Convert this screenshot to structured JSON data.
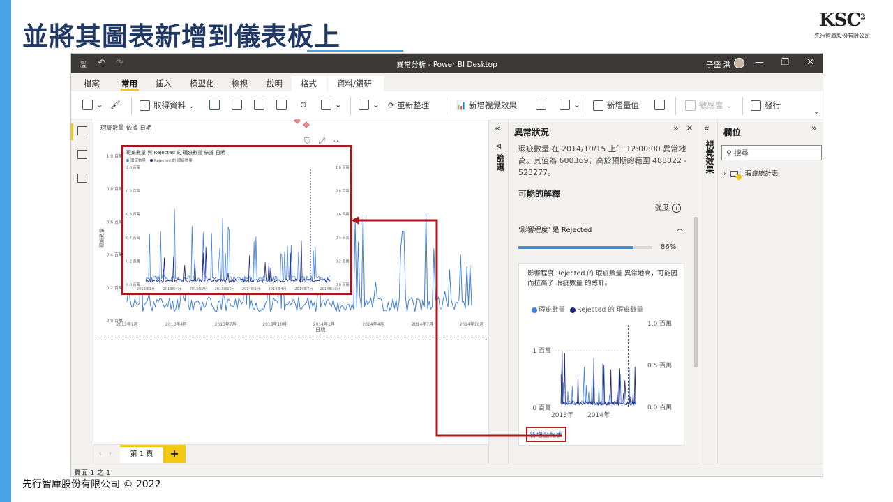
{
  "slide": {
    "title": "並將其圖表新增到儀表板上",
    "footer": "先行智庫股份有限公司 © 2022",
    "logo_main": "KSC",
    "logo_sup": "2",
    "logo_sub": "先行智庫股份有限公司"
  },
  "window": {
    "title": "異常分析 - Power BI Desktop",
    "user": "子盛 洪"
  },
  "menu": {
    "items": [
      "檔案",
      "常用",
      "插入",
      "模型化",
      "檢視",
      "說明",
      "格式",
      "資料/鑽研"
    ],
    "active": "常用"
  },
  "ribbon": {
    "get_data": "取得資料",
    "refresh": "重新整理",
    "new_visual": "新增視覺效果",
    "new_measure": "新增量值",
    "sensitivity": "敏感度",
    "publish": "發行"
  },
  "visual": {
    "title": "瑕疵數量 依據 日期",
    "x_label": "日期",
    "y_label": "瑕疵數量",
    "y_ticks": [
      "1.0 百萬",
      "0.8 百萬",
      "0.6 百萬",
      "0.4 百萬",
      "0.2 百萬",
      "0.0 百萬"
    ],
    "x_ticks": [
      "2013年1月",
      "2013年4月",
      "2013年7月",
      "2013年10月",
      "2014年1月",
      "2014年4月",
      "2014年7月",
      "2014年10月"
    ]
  },
  "inset": {
    "title": "瑕疵數量 與 Rejected 的 瑕疵數量 依據 日期",
    "legend": [
      "瑕疵數量",
      "Rejected 的 瑕疵數量"
    ],
    "y_ticks": [
      "1.0 百萬",
      "0.8 百萬",
      "0.6 百萬",
      "0.4 百萬",
      "0.2 百萬",
      "0.0 百萬"
    ],
    "x_ticks": [
      "2013年1月",
      "2013年4月",
      "2013年7月",
      "2013年10月",
      "2014年1月",
      "2014年4月",
      "2014年7月",
      "2014年10月"
    ]
  },
  "tabs": {
    "page": "第 1 頁",
    "add": "+",
    "status": "頁面 1 之 1"
  },
  "filters": {
    "label": "篩選"
  },
  "anomaly": {
    "title": "異常狀況",
    "description": "瑕疵數量 在 2014/10/15 上午 12:00:00 異常地高。其值為 600369，高於預期的範圍 488022 - 523277。",
    "subtitle": "可能的解釋",
    "strength_label": "強度",
    "factor": "'影響程度' 是 Rejected",
    "percent_text": "86%",
    "percent": 0.86,
    "card_text": "影響程度 Rejected 的 瑕疵數量 異常地高，可能因而拉高了 瑕疵數量 的總計。",
    "legend": [
      "瑕疵數量",
      "Rejected 的 瑕疵數量"
    ],
    "left_ticks": [
      "1 百萬",
      "0 百萬"
    ],
    "right_ticks": [
      "1.0 百萬",
      "0.5 百萬",
      "0.0 百萬"
    ],
    "x_ticks": [
      "2013年",
      "2014年"
    ],
    "add_to_report": "新增至報表"
  },
  "viz_strip": {
    "label": "視覺效果"
  },
  "fields": {
    "title": "欄位",
    "search_placeholder": "搜尋",
    "table_name": "瑕疵統計表"
  },
  "colors": {
    "series_light": "#3f7fe0",
    "series_dark": "#1b237d",
    "anomaly_marker": "#e88a8a",
    "highlight": "#a8171c",
    "accent": "#f2c811"
  }
}
